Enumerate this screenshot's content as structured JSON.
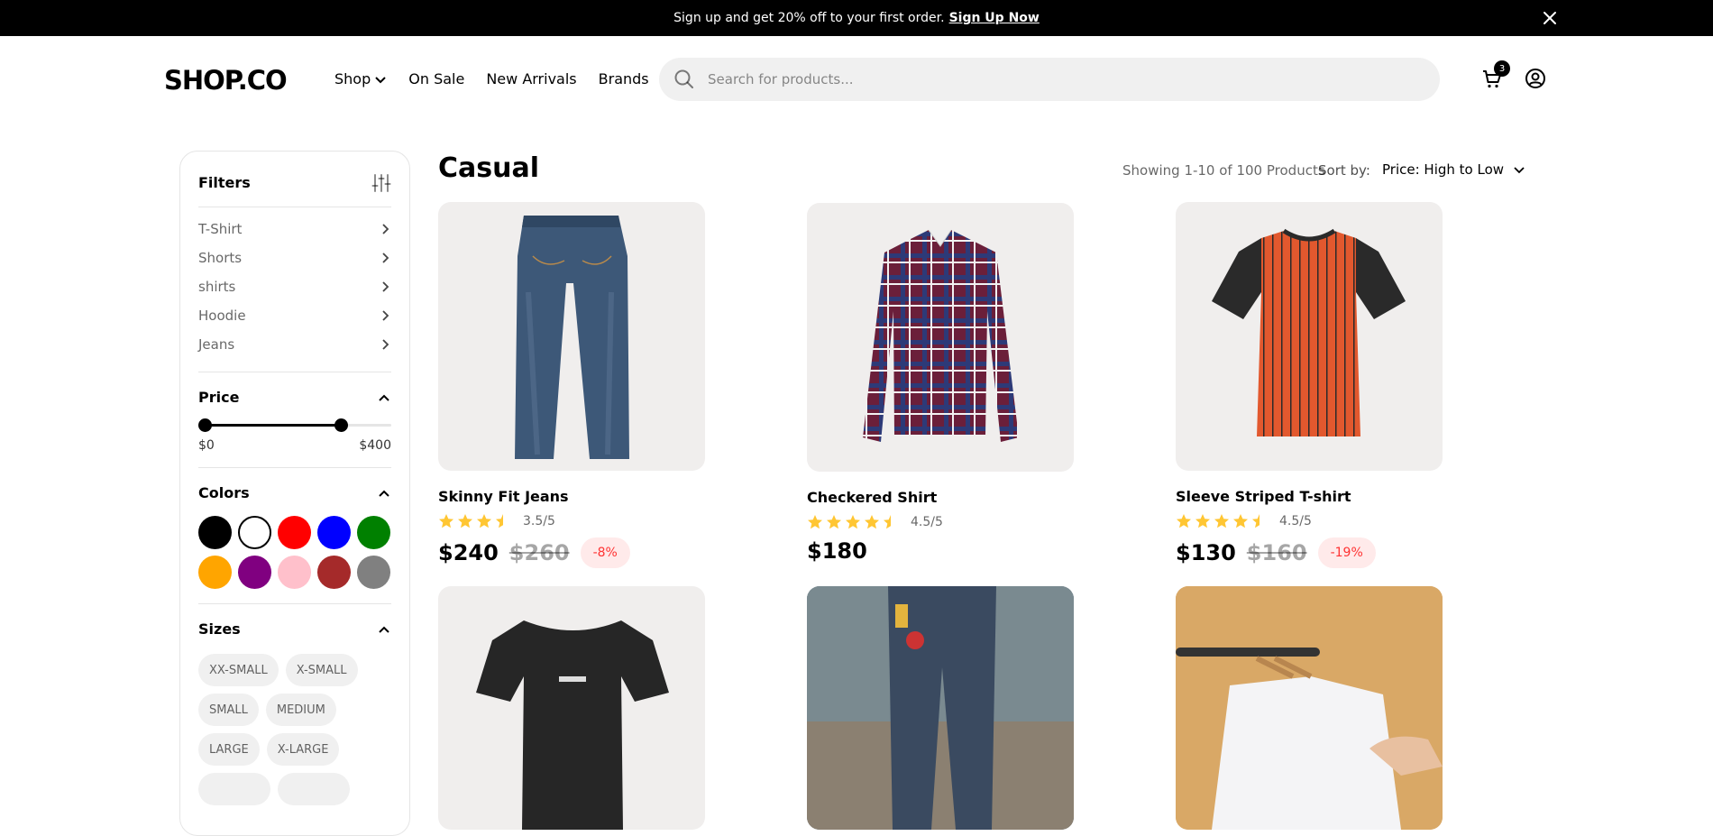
{
  "promo": {
    "text": "Sign up and get 20% off to your first order.",
    "link": "Sign Up Now"
  },
  "header": {
    "logo": "SHOP.CO",
    "nav": [
      "Shop",
      "On Sale",
      "New Arrivals",
      "Brands"
    ],
    "search_placeholder": "Search for products...",
    "cart_count": "3"
  },
  "filters": {
    "title": "Filters",
    "categories": [
      "T-Shirt",
      "Shorts",
      "shirts",
      "Hoodie",
      "Jeans"
    ],
    "price": {
      "title": "Price",
      "min_label": "$0",
      "max_label": "$400",
      "range_min": 0,
      "range_max": 400,
      "selected_max": 300
    },
    "colors": {
      "title": "Colors",
      "swatches": [
        "#000000",
        "#ffffff",
        "#ff0000",
        "#0000ff",
        "#008000",
        "#ffa500",
        "#800080",
        "#ffc0cb",
        "#a52a2a",
        "#808080"
      ]
    },
    "sizes": {
      "title": "Sizes",
      "options": [
        "XX-SMALL",
        "X-SMALL",
        "SMALL",
        "MEDIUM",
        "LARGE",
        "X-LARGE"
      ]
    }
  },
  "main": {
    "title": "Casual",
    "showing": "Showing 1-10 of 100 Products",
    "sort_label": "Sort by:",
    "sort_value": "Price: High to Low"
  },
  "products": [
    {
      "name": "Skinny Fit Jeans",
      "rating": "3.5/5",
      "stars": 3.5,
      "price": "$240",
      "old_price": "$260",
      "discount": "-8%"
    },
    {
      "name": "Checkered Shirt",
      "rating": "4.5/5",
      "stars": 4.5,
      "price": "$180"
    },
    {
      "name": "Sleeve Striped T-shirt",
      "rating": "4.5/5",
      "stars": 4.5,
      "price": "$130",
      "old_price": "$160",
      "discount": "-19%"
    }
  ],
  "colors": {
    "star": "#FFC633",
    "discount": "#FF3333",
    "card_bg": "#F0EEED"
  }
}
